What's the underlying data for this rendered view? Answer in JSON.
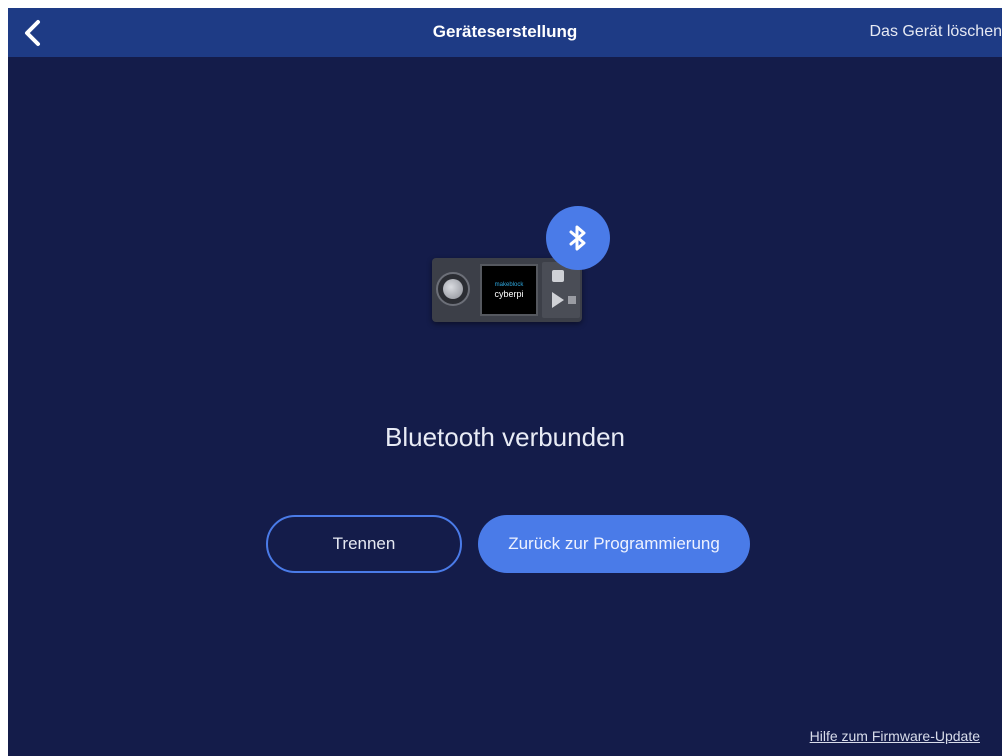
{
  "header": {
    "title": "Geräteserstellung",
    "delete_label": "Das Gerät löschen",
    "back_icon": "chevron-left-icon"
  },
  "device": {
    "brand": "makeblock",
    "model": "cyberpi",
    "badge_icon": "bluetooth-icon"
  },
  "status": {
    "text": "Bluetooth verbunden"
  },
  "actions": {
    "disconnect_label": "Trennen",
    "back_to_programming_label": "Zurück zur Programmierung"
  },
  "footer": {
    "help_link": "Hilfe zum Firmware-Update"
  },
  "colors": {
    "background": "#141c4a",
    "header": "#1e3b85",
    "accent": "#4a7be8"
  }
}
